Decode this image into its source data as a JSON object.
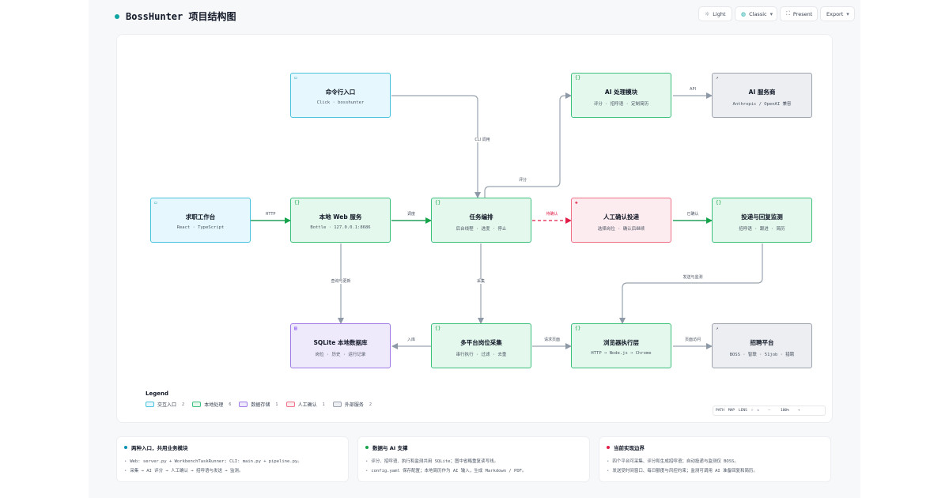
{
  "header": {
    "title": "BossHunter 项目结构图",
    "accent": "#0ea5a3",
    "buttons": {
      "theme": {
        "label": "Light",
        "icon": "sun-icon"
      },
      "style": {
        "label": "Classic",
        "icon": "palette-icon"
      },
      "present": {
        "label": "Present",
        "icon": "fullscreen-icon"
      },
      "export": {
        "label": "Export"
      }
    }
  },
  "nodes": {
    "cli": {
      "title": "命令行入口",
      "subtitle": "Click · bosshunter",
      "category": "interaction"
    },
    "workbench": {
      "title": "求职工作台",
      "subtitle": "React · TypeScript",
      "category": "interaction"
    },
    "web": {
      "title": "本地 Web 服务",
      "subtitle": "Bottle · 127.0.0.1:8686",
      "category": "local"
    },
    "orchestrator": {
      "title": "任务编排",
      "subtitle": "后台线程 · 进度 · 停止",
      "category": "local"
    },
    "ai": {
      "title": "AI 处理模块",
      "subtitle": "评分 · 招呼语 · 定制简历",
      "category": "local"
    },
    "provider": {
      "title": "AI 服务商",
      "subtitle": "Anthropic / OpenAI 兼容",
      "category": "external"
    },
    "confirm": {
      "title": "人工确认投递",
      "subtitle": "选择岗位 · 确认后继续",
      "category": "human"
    },
    "monitor": {
      "title": "投递与回复监测",
      "subtitle": "招呼语 · 跟进 · 简历",
      "category": "local"
    },
    "sqlite": {
      "title": "SQLite 本地数据库",
      "subtitle": "岗位 · 历史 · 运行记录",
      "category": "storage"
    },
    "collect": {
      "title": "多平台岗位采集",
      "subtitle": "串行执行 · 过滤 · 去重",
      "category": "local"
    },
    "browser": {
      "title": "浏览器执行层",
      "subtitle": "HTTP → Node.js → Chrome",
      "category": "local"
    },
    "platform": {
      "title": "招聘平台",
      "subtitle": "BOSS · 智联 · 51job · 猎聘",
      "category": "external"
    }
  },
  "edge_labels": {
    "cli_call": "CLI 调用",
    "http": "HTTP",
    "schedule": "调度",
    "pending": "待确认",
    "confirmed": "已确认",
    "score": "评分",
    "api": "API",
    "query_update": "查询与更新",
    "collect": "采集",
    "store": "入库",
    "request_page": "请求页面",
    "send_monitor": "发送与监测",
    "page_access": "页面访问"
  },
  "legend": {
    "title": "Legend",
    "items": [
      {
        "label": "交互入口",
        "count": "2",
        "fill": "#e6f8fd",
        "stroke": "#49c3dd"
      },
      {
        "label": "本地处理",
        "count": "6",
        "fill": "#e4f8ed",
        "stroke": "#3cbf7d"
      },
      {
        "label": "数据存储",
        "count": "1",
        "fill": "#efe9fc",
        "stroke": "#9f7ae6"
      },
      {
        "label": "人工确认",
        "count": "1",
        "fill": "#fdecef",
        "stroke": "#ee6f86"
      },
      {
        "label": "外部服务",
        "count": "2",
        "fill": "#eceef1",
        "stroke": "#9ca3af"
      }
    ]
  },
  "zoom": {
    "path": "PATH",
    "map": "MAP",
    "lens": "LENS",
    "level": "100%"
  },
  "cards": [
    {
      "title": "两种入口，共用业务模块",
      "dot_color": "#0891b2",
      "items": [
        "Web: server.py + WorkbenchTaskRunner; CLI: main.py + pipeline.py。",
        "采集 → AI 评分 → 人工确认 → 招呼语与发送 → 监测。"
      ]
    },
    {
      "title": "数据与 AI 支撑",
      "dot_color": "#16a34a",
      "items": [
        "评分、招呼语、执行和监测共用 SQLite；图中省略重复读写线。",
        "config.yaml 保存配置；本地简历作为 AI 输入，生成 Markdown / PDF。"
      ]
    },
    {
      "title": "当前实现边界",
      "dot_color": "#e11d48",
      "items": [
        "四个平台可采集、评分和生成招呼语；自动投递与监测仅 BOSS。",
        "发送受时间窗口、每日额度与风控约束；监测可调用 AI 准备回复和简历。"
      ]
    }
  ]
}
